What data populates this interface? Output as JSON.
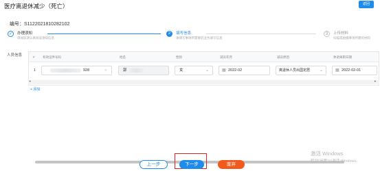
{
  "header": {
    "title": "医疗离退休减少（死亡）",
    "top_button_label": "返回",
    "id_line": "编号：S1122021810282102"
  },
  "steps": [
    {
      "num": "✓",
      "title": "办理须知",
      "desc": "审阅前请认真阅读须知信息",
      "state": "done"
    },
    {
      "num": "2",
      "title": "填写信息",
      "desc": "请填写事项所需要的业务填写信息",
      "state": "active"
    },
    {
      "num": "3",
      "title": "上传材料",
      "desc": "扫描或拍摄事项所需的材料",
      "state": "todo"
    }
  ],
  "persons_section": {
    "label": "人员信息",
    "columns": [
      "#",
      "有效证件号码",
      "姓名",
      "性别",
      "减员年月",
      "减员原因",
      "休退离职日期"
    ],
    "rows": [
      {
        "index": "1",
        "id_number_suffix": "928",
        "name_prefix": "郭",
        "gender": "女",
        "reduce_month": "2022-02",
        "reason": "离退休人员出国定居",
        "date": "2022-02-01"
      }
    ],
    "add_link": "+ 添加"
  },
  "icons": {
    "search": "search-icon",
    "calendar": "calendar-icon",
    "chevron": "chevron-down-icon"
  },
  "actions": {
    "prev": "上一步",
    "next": "下一步",
    "abandon": "废弃"
  },
  "watermark": {
    "line1": "激活 Windows",
    "line2": "转到\"设置\"以激活 Windows。"
  },
  "colors": {
    "primary": "#1f8ceb",
    "danger": "#f25a1d",
    "highlight_box": "#e02020"
  }
}
